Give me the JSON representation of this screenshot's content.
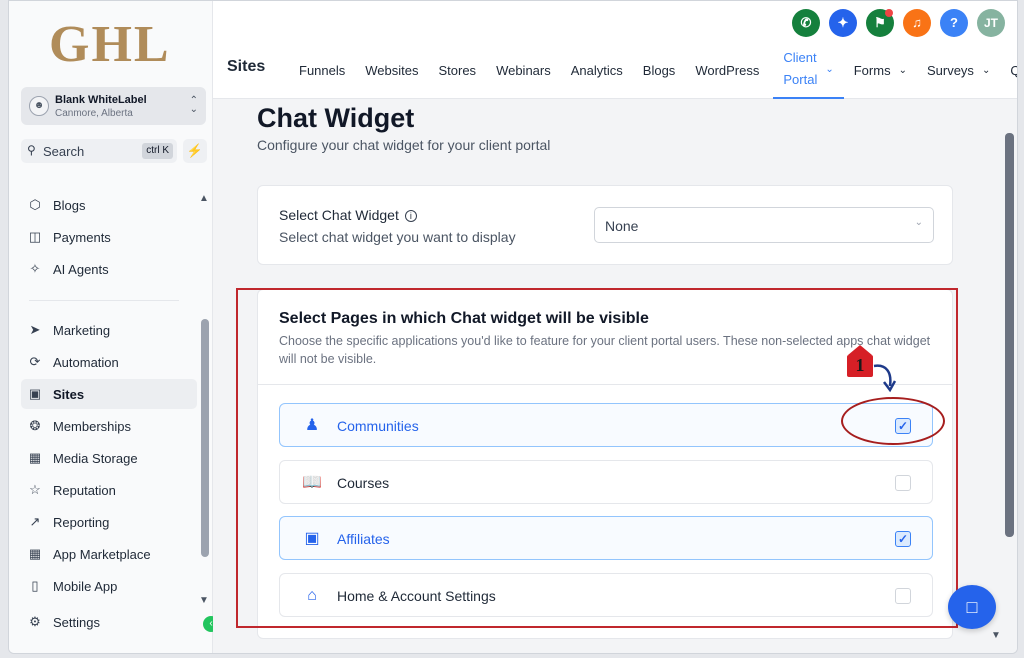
{
  "brand": {
    "logo_text": "GHL"
  },
  "account": {
    "name": "Blank WhiteLabel",
    "location": "Canmore, Alberta"
  },
  "search": {
    "label": "Search",
    "shortcut": "ctrl K"
  },
  "sidebar": {
    "items": [
      {
        "label": "Blogs",
        "icon": "cube-icon"
      },
      {
        "label": "Payments",
        "icon": "payments-icon"
      },
      {
        "label": "AI Agents",
        "icon": "sparkle-icon"
      },
      {
        "label": "Marketing",
        "icon": "send-icon"
      },
      {
        "label": "Automation",
        "icon": "automation-icon"
      },
      {
        "label": "Sites",
        "icon": "sites-icon",
        "active": true
      },
      {
        "label": "Memberships",
        "icon": "award-icon"
      },
      {
        "label": "Media Storage",
        "icon": "image-icon"
      },
      {
        "label": "Reputation",
        "icon": "star-icon"
      },
      {
        "label": "Reporting",
        "icon": "trend-icon"
      },
      {
        "label": "App Marketplace",
        "icon": "grid-icon"
      },
      {
        "label": "Mobile App",
        "icon": "mobile-icon"
      },
      {
        "label": "Settings",
        "icon": "gear-icon"
      }
    ]
  },
  "topbar": {
    "section_title": "Sites",
    "avatar_initials": "JT",
    "help_label": "?",
    "tabs": [
      {
        "label": "Funnels"
      },
      {
        "label": "Websites"
      },
      {
        "label": "Stores"
      },
      {
        "label": "Webinars"
      },
      {
        "label": "Analytics"
      },
      {
        "label": "Blogs"
      },
      {
        "label": "WordPress"
      },
      {
        "label_line1": "Client",
        "label_line2": "Portal",
        "active": true,
        "dropdown": true
      },
      {
        "label": "Forms",
        "dropdown": true
      },
      {
        "label": "Surveys",
        "dropdown": true
      },
      {
        "label": "Q"
      }
    ]
  },
  "page": {
    "title": "Chat Widget",
    "subtitle": "Configure your chat widget for your client portal"
  },
  "widget_select": {
    "label": "Select Chat Widget",
    "help": "Select chat widget you want to display",
    "value": "None"
  },
  "pages_card": {
    "title": "Select Pages in which Chat widget will be visible",
    "description": "Choose the specific applications you'd like to feature for your client portal users. These non-selected apps chat widget will not be visible.",
    "apps": [
      {
        "label": "Communities",
        "icon": "users-icon",
        "checked": true
      },
      {
        "label": "Courses",
        "icon": "book-icon",
        "checked": false
      },
      {
        "label": "Affiliates",
        "icon": "briefcase-icon",
        "checked": true
      },
      {
        "label": "Home & Account Settings",
        "icon": "home-icon",
        "checked": false
      }
    ]
  },
  "annotation": {
    "step_number": "1"
  },
  "colors": {
    "accent": "#2563eb",
    "annotation_red": "#c0272d",
    "logo_gold": "#b08c5a"
  }
}
